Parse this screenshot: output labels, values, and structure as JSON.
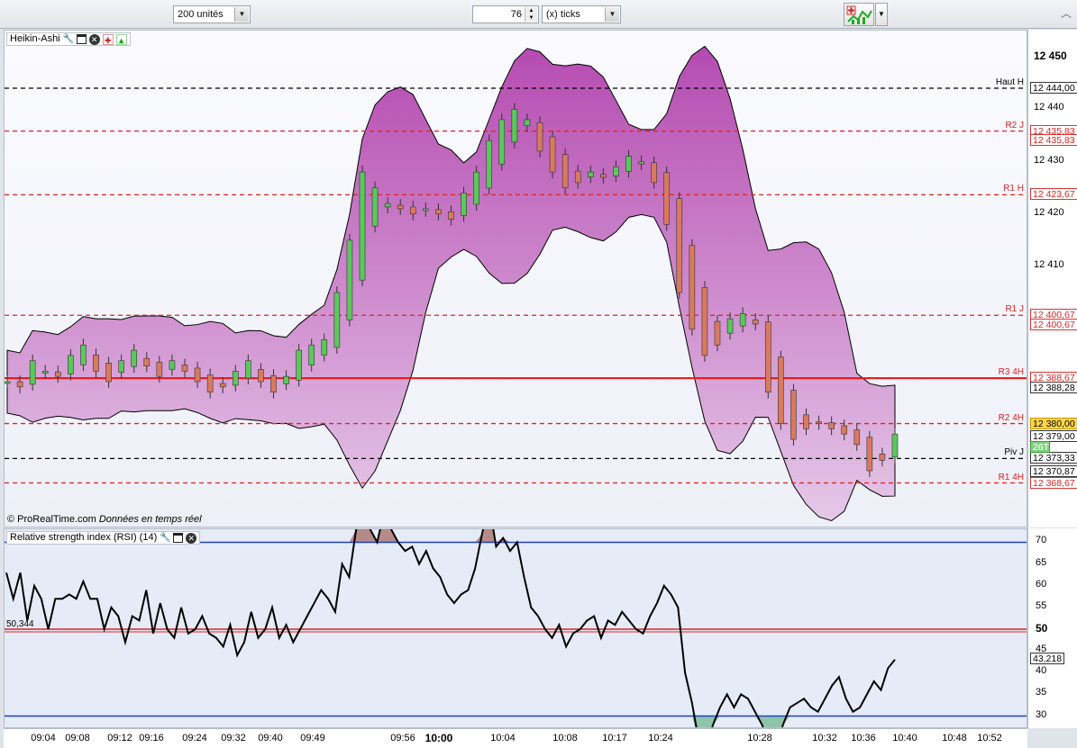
{
  "toolbar": {
    "units_value": "200 unités",
    "ticks_value": "76",
    "ticks_unit": "(x) ticks",
    "collapse_icon": "chevron-up-icon"
  },
  "price_panel": {
    "title": "Heikin-Ashi",
    "credit_brand": "© ProRealTime.com",
    "credit_note": "Données en temps réel",
    "axis_ticks": [
      "12 450",
      "12 440",
      "12 430",
      "12 420",
      "12 410"
    ],
    "axis_tick_values": [
      12450,
      12440,
      12430,
      12420,
      12410
    ],
    "levels": [
      {
        "label": "Haut H",
        "tag": "12 444,00",
        "value": 12444.0,
        "color": "#000000",
        "style": "dashed"
      },
      {
        "label": "R2 J",
        "tag": "12 435,83",
        "value": 12435.83,
        "color": "#dd2222",
        "style": "dashed"
      },
      {
        "label": "R1 H",
        "tag": "12 423,67",
        "value": 12423.67,
        "color": "#dd2222",
        "style": "dashed"
      },
      {
        "label": "R1 J",
        "tag": "12 400,67",
        "value": 12400.67,
        "color": "#dd2222",
        "style": "dashed"
      },
      {
        "label": "R3 4H",
        "tag": "12 388,67",
        "value": 12388.67,
        "color": "#ee1111",
        "style": "solid"
      },
      {
        "label": "R2 4H",
        "tag": "12 380,00",
        "value": 12380.0,
        "color": "#dd2222",
        "style": "dashed"
      },
      {
        "label": "Piv J",
        "tag": "12 373,33",
        "value": 12373.33,
        "color": "#000000",
        "style": "dashed"
      },
      {
        "label": "R1 4H",
        "tag": "12 368,67",
        "value": 12368.67,
        "color": "#dd2222",
        "style": "dashed"
      }
    ],
    "extra_tags": [
      {
        "text": "12 435,83",
        "value": 12434.0,
        "kind": "red"
      },
      {
        "text": "12 400,67",
        "value": 12398.9,
        "kind": "red"
      },
      {
        "text": "12 388,28",
        "value": 12386.8,
        "kind": "black"
      },
      {
        "text": "12 380,00",
        "value": 12380.0,
        "kind": "yellow"
      },
      {
        "text": "12 379,00",
        "value": 12377.6,
        "kind": "black"
      },
      {
        "text": "26T",
        "value": 12375.4,
        "kind": "green"
      },
      {
        "text": "12 370,87",
        "value": 12370.8,
        "kind": "black"
      }
    ]
  },
  "rsi_panel": {
    "title": "Relative strength index (RSI) (14)",
    "axis_ticks": [
      "70",
      "65",
      "60",
      "55",
      "50",
      "45",
      "40",
      "35",
      "30"
    ],
    "axis_tick_values": [
      70,
      65,
      60,
      55,
      50,
      45,
      40,
      35,
      30
    ],
    "current_value": "43,218",
    "left_value": "50,344",
    "levels": [
      70,
      50,
      30
    ]
  },
  "time_axis": {
    "labels": [
      "09:04",
      "09:08",
      "09:12",
      "09:16",
      "09:24",
      "09:32",
      "09:40",
      "09:49",
      "09:56",
      "10:00",
      "10:04",
      "10:08",
      "10:17",
      "10:24",
      "10:28",
      "10:32",
      "10:36",
      "10:40",
      "10:48",
      "10:52"
    ],
    "bold_label": "10:00"
  },
  "chart_data": [
    {
      "type": "candlestick",
      "title": "Heikin-Ashi",
      "ylim": [
        12360,
        12455
      ],
      "x_labels": [
        "09:04",
        "09:08",
        "09:12",
        "09:16",
        "09:24",
        "09:32",
        "09:40",
        "09:49",
        "09:56",
        "10:00",
        "10:04",
        "10:08",
        "10:17",
        "10:24",
        "10:28",
        "10:32",
        "10:36",
        "10:40",
        "10:48",
        "10:52"
      ],
      "close_path": [
        12388,
        12387,
        12392,
        12390,
        12389,
        12393,
        12395,
        12390,
        12388,
        12392,
        12394,
        12391,
        12389,
        12392,
        12390,
        12388,
        12386,
        12387,
        12390,
        12392,
        12388,
        12386,
        12389,
        12394,
        12395,
        12396,
        12405,
        12415,
        12428,
        12425,
        12422,
        12421,
        12420,
        12421,
        12420,
        12419,
        12424,
        12428,
        12434,
        12438,
        12440,
        12438,
        12432,
        12428,
        12425,
        12426,
        12428,
        12427,
        12429,
        12431,
        12430,
        12426,
        12418,
        12405,
        12398,
        12393,
        12395,
        12400,
        12401,
        12399,
        12386,
        12380,
        12377,
        12379,
        12380,
        12379,
        12378,
        12376,
        12371,
        12373,
        12378
      ]
    },
    {
      "type": "line",
      "title": "Relative strength index (RSI) (14)",
      "ylim": [
        27,
        73
      ],
      "values": [
        63,
        57,
        63,
        52,
        60,
        57,
        50,
        57,
        57,
        58,
        57,
        61,
        57,
        57,
        50,
        55,
        53,
        47,
        53,
        52,
        59,
        49,
        56,
        50,
        48,
        55,
        49,
        50,
        53,
        49,
        48,
        46,
        51,
        44,
        47,
        54,
        48,
        50,
        55,
        48,
        51,
        47,
        50,
        53,
        56,
        59,
        57,
        54,
        65,
        62,
        73,
        80,
        73,
        70,
        77,
        73,
        70,
        68,
        69,
        65,
        68,
        64,
        62,
        58,
        56,
        58,
        59,
        64,
        72,
        79,
        69,
        71,
        68,
        70,
        62,
        55,
        53,
        50,
        48,
        51,
        46,
        49,
        50,
        52,
        53,
        48,
        52,
        51,
        54,
        52,
        50,
        49,
        53,
        56,
        60,
        58,
        55,
        40,
        33,
        24,
        22,
        28,
        32,
        35,
        32,
        35,
        34,
        31,
        28,
        24,
        22,
        28,
        32,
        33,
        34,
        32,
        31,
        34,
        37,
        39,
        34,
        31,
        32,
        35,
        38,
        36,
        41,
        43
      ]
    }
  ]
}
